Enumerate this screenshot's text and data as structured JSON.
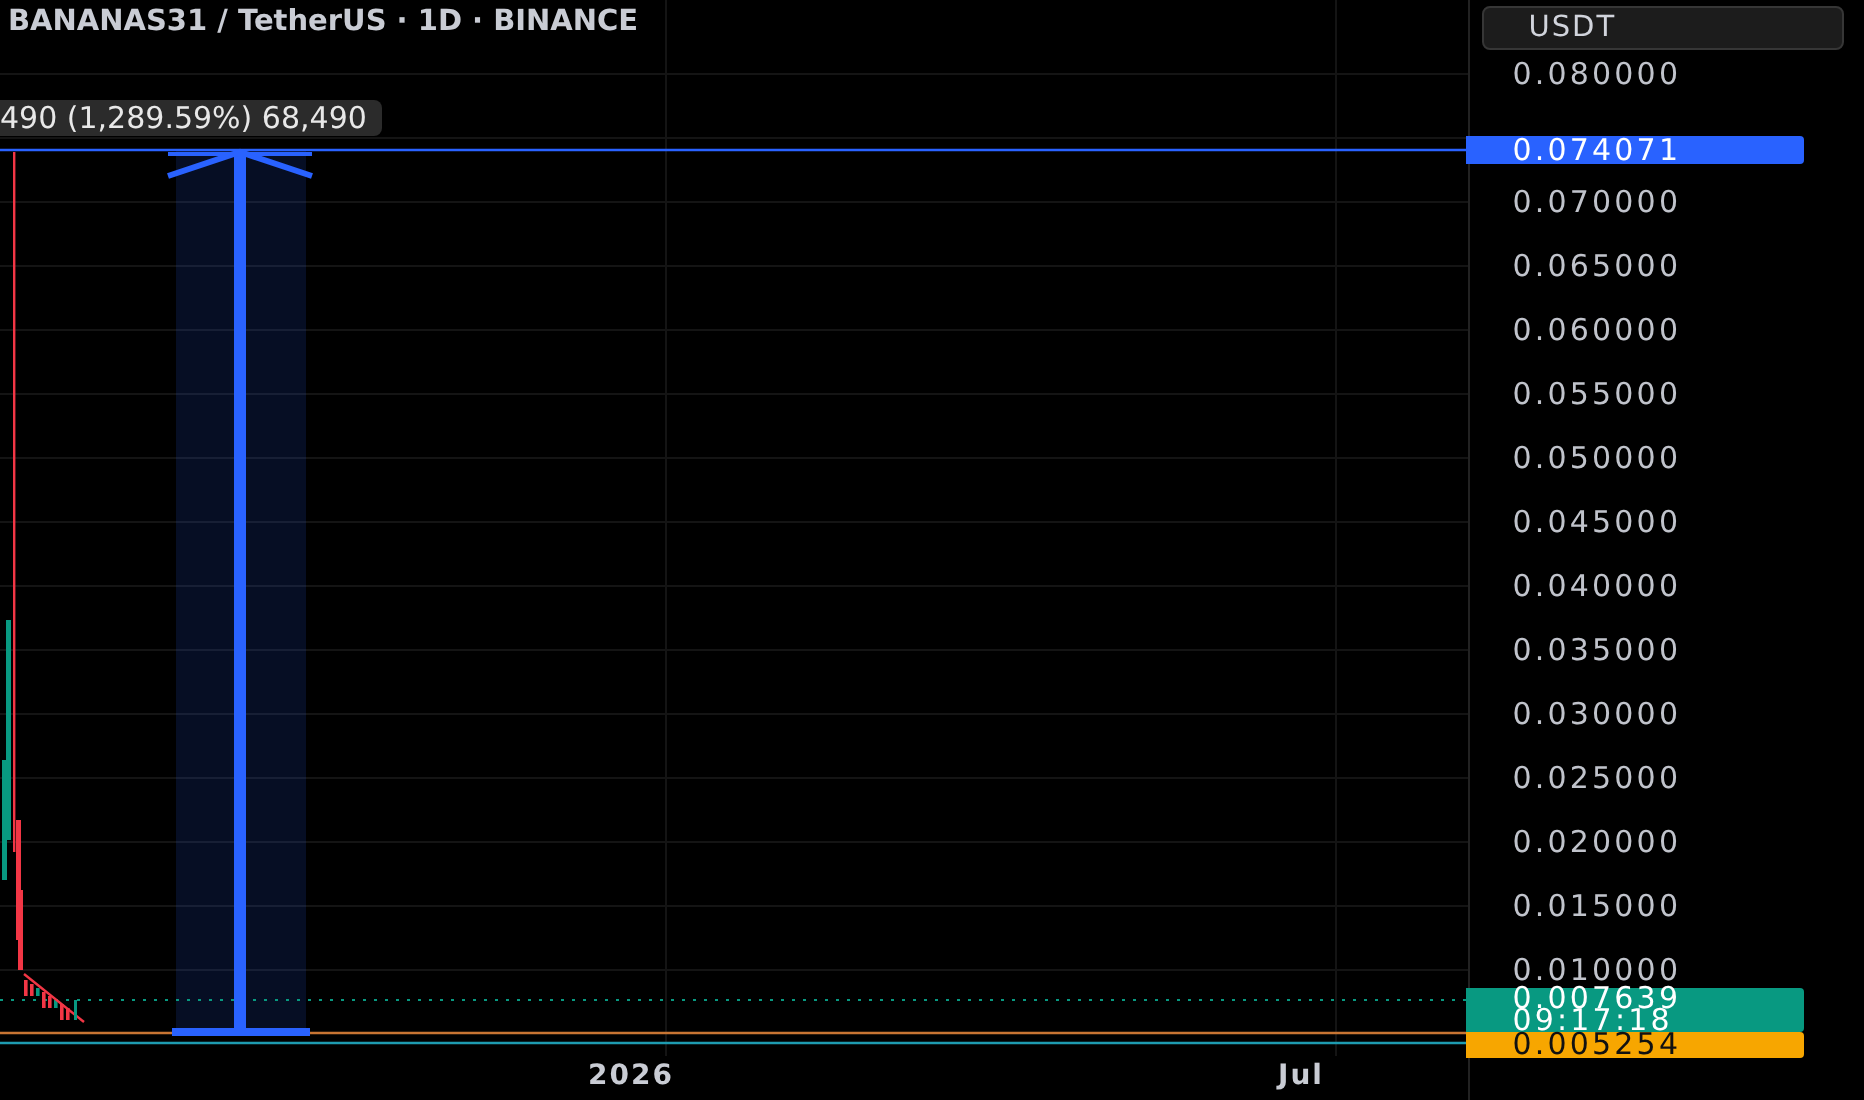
{
  "legend": {
    "symbol": "BANANAS31 / TetherUS · 1D · BINANCE"
  },
  "currency_button": {
    "label": "USDT"
  },
  "measure_label": {
    "text": "490 (1,289.59%) 68,490"
  },
  "price_axis": {
    "ticks": [
      "0.080000",
      "0.070000",
      "0.065000",
      "0.060000",
      "0.055000",
      "0.050000",
      "0.045000",
      "0.040000",
      "0.035000",
      "0.030000",
      "0.025000",
      "0.020000",
      "0.015000",
      "0.010000"
    ]
  },
  "price_labels": [
    {
      "kind": "line",
      "text": "0.074071",
      "color": "#2962ff"
    },
    {
      "kind": "last",
      "text": "0.007639",
      "countdown": "09:17:18",
      "color": "#089981"
    },
    {
      "kind": "low",
      "text": "0.005254",
      "color": "#f7a600"
    }
  ],
  "time_axis": {
    "labels": [
      "2026",
      "Jul"
    ]
  }
}
